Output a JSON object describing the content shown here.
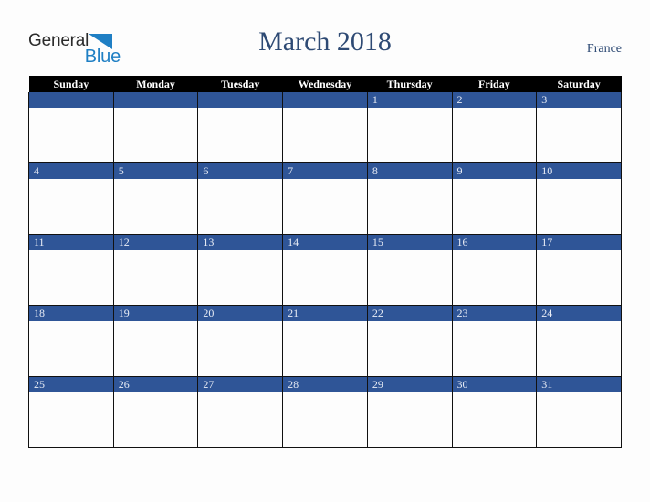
{
  "brand": {
    "name_part1": "General",
    "name_part2": "Blue",
    "triangle_color": "#1f7fc4",
    "text_color": "#2b2b2b"
  },
  "header": {
    "title": "March 2018",
    "country": "France",
    "title_color": "#2e4a74"
  },
  "calendar": {
    "accent_color": "#2f5597",
    "header_bg": "#000000",
    "day_headers": [
      "Sunday",
      "Monday",
      "Tuesday",
      "Wednesday",
      "Thursday",
      "Friday",
      "Saturday"
    ],
    "weeks": [
      [
        "",
        "",
        "",
        "",
        "1",
        "2",
        "3"
      ],
      [
        "4",
        "5",
        "6",
        "7",
        "8",
        "9",
        "10"
      ],
      [
        "11",
        "12",
        "13",
        "14",
        "15",
        "16",
        "17"
      ],
      [
        "18",
        "19",
        "20",
        "21",
        "22",
        "23",
        "24"
      ],
      [
        "25",
        "26",
        "27",
        "28",
        "29",
        "30",
        "31"
      ]
    ]
  }
}
